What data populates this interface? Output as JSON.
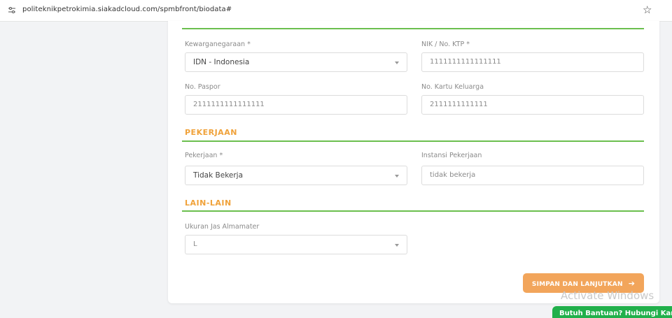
{
  "browser": {
    "url": "politeknikpetrokimia.siakadcloud.com/spmbfront/biodata#"
  },
  "form": {
    "kewarganegaraan": {
      "label": "Kewarganegaraan *",
      "value": "IDN - Indonesia"
    },
    "nik": {
      "label": "NIK / No. KTP *",
      "value": "1111111111111111"
    },
    "paspor": {
      "label": "No. Paspor",
      "value": "2111111111111111"
    },
    "kk": {
      "label": "No. Kartu Keluarga",
      "value": "2111111111111"
    },
    "pekerjaan_section": "PEKERJAAN",
    "pekerjaan": {
      "label": "Pekerjaan *",
      "value": "Tidak Bekerja"
    },
    "instansi": {
      "label": "Instansi Pekerjaan",
      "value": "tidak bekerja"
    },
    "lainlain_section": "LAIN-LAIN",
    "jas": {
      "label": "Ukuran Jas Almamater",
      "value": "L"
    },
    "save_label": "SIMPAN DAN LANJUTKAN"
  },
  "watermark": "Activate Windows",
  "help_badge": "Butuh Bantuan? Hubungi Kami"
}
